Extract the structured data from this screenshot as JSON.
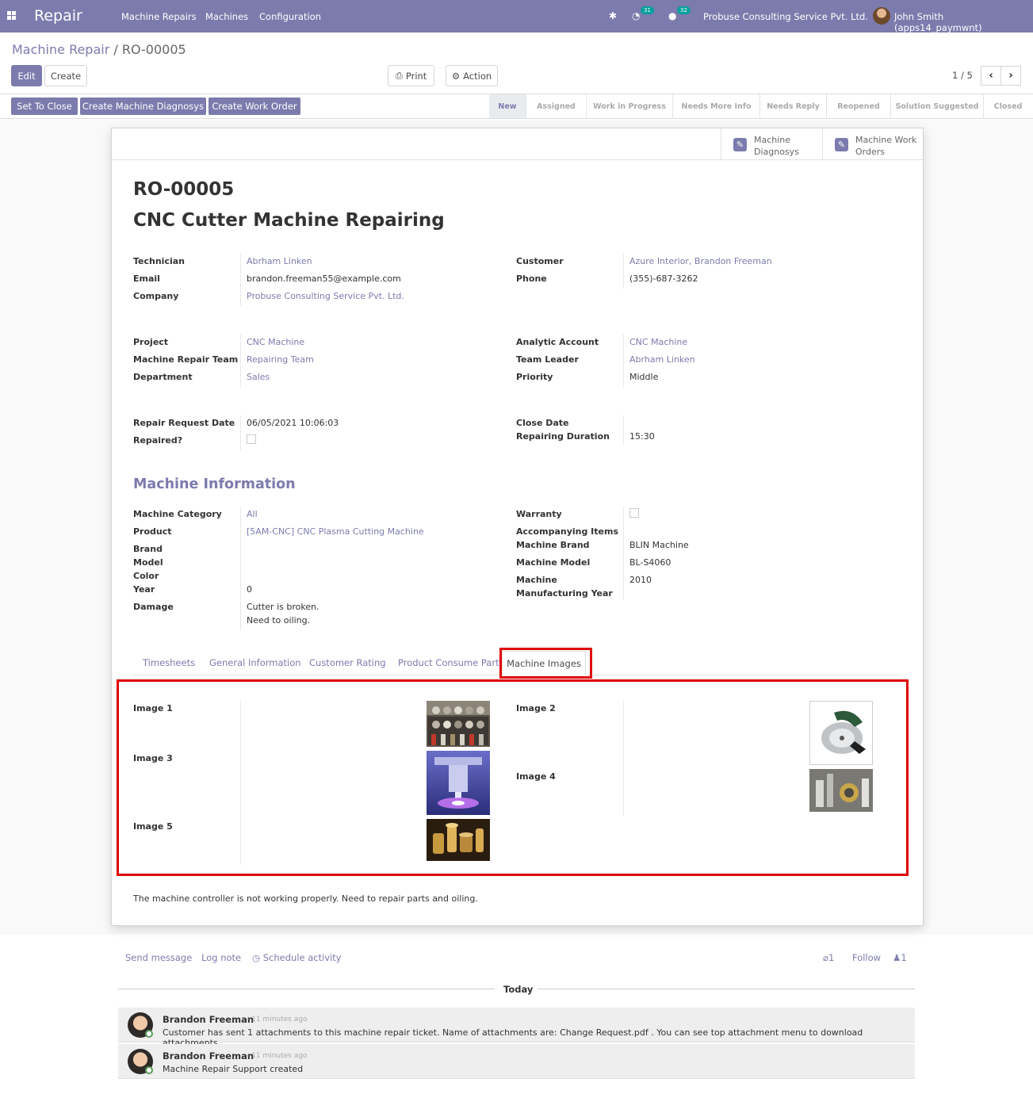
{
  "navbar": {
    "brand": "Repair",
    "menu": [
      "Machine Repairs",
      "Machines",
      "Configuration"
    ],
    "activity_count": "31",
    "message_count": "32",
    "company": "Probuse Consulting Service Pvt. Ltd.",
    "user": "John Smith (apps14_paymwnt)"
  },
  "breadcrumb": {
    "parent": "Machine Repair",
    "current": "RO-00005"
  },
  "buttons": {
    "edit": "Edit",
    "create": "Create",
    "print": "Print",
    "action": "Action"
  },
  "pager": "1 / 5",
  "header_buttons": [
    "Set To Close",
    "Create Machine Diagnosys",
    "Create Work Order"
  ],
  "stages": [
    "New",
    "Assigned",
    "Work in Progress",
    "Needs More Info",
    "Needs Reply",
    "Reopened",
    "Solution Suggested",
    "Closed"
  ],
  "active_stage": "New",
  "smart_buttons": [
    {
      "line1": "Machine",
      "line2": "Diagnosys",
      "icon": "edit-icon"
    },
    {
      "line1": "Machine Work",
      "line2": "Orders",
      "icon": "edit-icon"
    }
  ],
  "record": {
    "ref": "RO-00005",
    "name": "CNC Cutter Machine Repairing"
  },
  "fields": {
    "technician": {
      "label": "Technician",
      "value": "Abrham Linken"
    },
    "email": {
      "label": "Email",
      "value": "brandon.freeman55@example.com"
    },
    "company": {
      "label": "Company",
      "value": "Probuse Consulting Service Pvt. Ltd."
    },
    "customer": {
      "label": "Customer",
      "value": "Azure Interior, Brandon Freeman"
    },
    "phone": {
      "label": "Phone",
      "value": "(355)-687-3262"
    },
    "project": {
      "label": "Project",
      "value": "CNC Machine"
    },
    "repair_team": {
      "label": "Machine Repair Team",
      "value": "Repairing Team"
    },
    "department": {
      "label": "Department",
      "value": "Sales"
    },
    "analytic_account": {
      "label": "Analytic Account",
      "value": "CNC Machine"
    },
    "team_leader": {
      "label": "Team Leader",
      "value": "Abrham Linken"
    },
    "priority": {
      "label": "Priority",
      "value": "Middle"
    },
    "request_date": {
      "label": "Repair Request Date",
      "value": "06/05/2021 10:06:03"
    },
    "repaired": {
      "label": "Repaired?"
    },
    "close_date": {
      "label": "Close Date",
      "value": ""
    },
    "duration": {
      "label": "Repairing Duration",
      "value": "15:30"
    }
  },
  "machine_info": {
    "title": "Machine Information",
    "category": {
      "label": "Machine Category",
      "value": "All"
    },
    "product": {
      "label": "Product",
      "value": "[5AM-CNC] CNC Plasma Cutting Machine"
    },
    "brand": {
      "label": "Brand",
      "value": ""
    },
    "model": {
      "label": "Model",
      "value": ""
    },
    "color": {
      "label": "Color",
      "value": ""
    },
    "year": {
      "label": "Year",
      "value": "0"
    },
    "damage": {
      "label": "Damage",
      "line1": "Cutter is broken.",
      "line2": "Need to oiling."
    },
    "warranty": {
      "label": "Warranty"
    },
    "accompanying": {
      "label": "Accompanying Items",
      "value": ""
    },
    "machine_brand": {
      "label": "Machine Brand",
      "value": "BLIN Machine"
    },
    "machine_model": {
      "label": "Machine Model",
      "value": "BL-S4060"
    },
    "mfg_year": {
      "label_line1": "Machine",
      "label_line2": "Manufacturing Year",
      "value": "2010"
    }
  },
  "tabs": [
    "Timesheets",
    "General Information",
    "Customer Rating",
    "Product Consume Part",
    "Machine Images"
  ],
  "images": {
    "image1": "Image 1",
    "image2": "Image 2",
    "image3": "Image 3",
    "image4": "Image 4",
    "image5": "Image 5"
  },
  "description": "The machine controller is not working properly. Need to repair parts and oiling.",
  "chatter": {
    "send_message": "Send message",
    "log_note": "Log note",
    "schedule_activity": "Schedule activity",
    "attachments": "1",
    "follow": "Follow",
    "followers": "1",
    "today": "Today",
    "messages": [
      {
        "author": "Brandon Freeman",
        "time": "- 11 minutes ago",
        "text": "Customer has sent 1 attachments to this machine repair ticket. Name of attachments are: Change Request.pdf . You can see top attachment menu to download attachments."
      },
      {
        "author": "Brandon Freeman",
        "time": "- 11 minutes ago",
        "text": "Machine Repair Support created"
      }
    ]
  }
}
